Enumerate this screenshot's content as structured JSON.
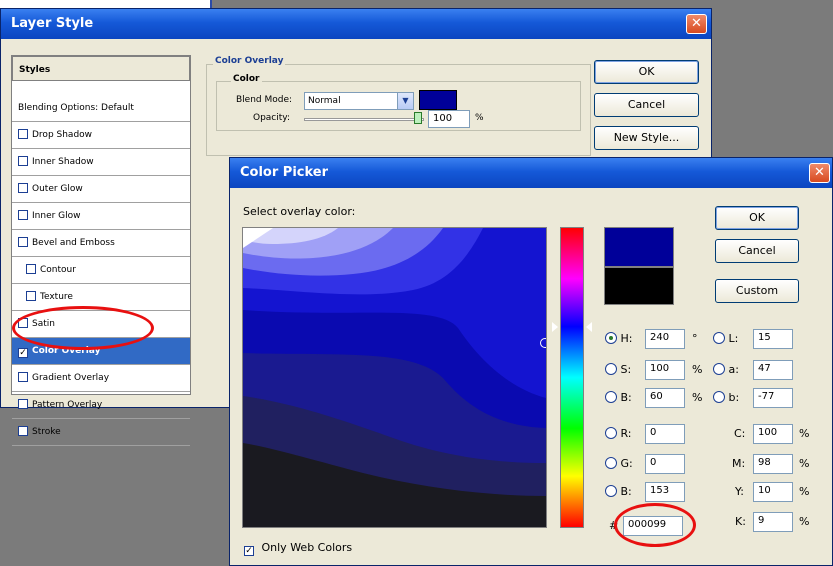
{
  "layer_style": {
    "title": "Layer Style",
    "styles_header": "Styles",
    "blending_options": "Blending Options: Default",
    "items": [
      {
        "label": "Drop Shadow",
        "checked": false
      },
      {
        "label": "Inner Shadow",
        "checked": false
      },
      {
        "label": "Outer Glow",
        "checked": false
      },
      {
        "label": "Inner Glow",
        "checked": false
      },
      {
        "label": "Bevel and Emboss",
        "checked": false
      },
      {
        "label": "Contour",
        "checked": false
      },
      {
        "label": "Texture",
        "checked": false
      },
      {
        "label": "Satin",
        "checked": false
      },
      {
        "label": "Color Overlay",
        "checked": true
      },
      {
        "label": "Gradient Overlay",
        "checked": false
      },
      {
        "label": "Pattern Overlay",
        "checked": false
      },
      {
        "label": "Stroke",
        "checked": false
      }
    ],
    "panel": {
      "section_title": "Color Overlay",
      "group_title": "Color",
      "blend_mode_label": "Blend Mode:",
      "blend_mode_value": "Normal",
      "opacity_label": "Opacity:",
      "opacity_value": "100",
      "opacity_unit": "%",
      "overlay_color": "#000099"
    },
    "buttons": {
      "ok": "OK",
      "cancel": "Cancel",
      "new_style": "New Style..."
    }
  },
  "color_picker": {
    "title": "Color Picker",
    "prompt": "Select overlay color:",
    "buttons": {
      "ok": "OK",
      "cancel": "Cancel",
      "custom": "Custom"
    },
    "new_color": "#000099",
    "current_color": "#000000",
    "fields": {
      "h": {
        "label": "H:",
        "value": "240",
        "unit": "°",
        "selected": true
      },
      "s": {
        "label": "S:",
        "value": "100",
        "unit": "%"
      },
      "b": {
        "label": "B:",
        "value": "60",
        "unit": "%"
      },
      "r": {
        "label": "R:",
        "value": "0"
      },
      "g": {
        "label": "G:",
        "value": "0"
      },
      "bl": {
        "label": "B:",
        "value": "153"
      },
      "l": {
        "label": "L:",
        "value": "15"
      },
      "a": {
        "label": "a:",
        "value": "47"
      },
      "lb": {
        "label": "b:",
        "value": "-77"
      },
      "c": {
        "label": "C:",
        "value": "100",
        "unit": "%"
      },
      "m": {
        "label": "M:",
        "value": "98",
        "unit": "%"
      },
      "y": {
        "label": "Y:",
        "value": "10",
        "unit": "%"
      },
      "k": {
        "label": "K:",
        "value": "9",
        "unit": "%"
      }
    },
    "hex_label": "#",
    "hex_value": "000099",
    "web_only_label": "Only Web Colors",
    "web_only_checked": true
  },
  "colors": {
    "title_bar": "#1559d8",
    "dialog_bg": "#ece9d8",
    "selection": "#316ac5",
    "highlight": "#e81010"
  }
}
